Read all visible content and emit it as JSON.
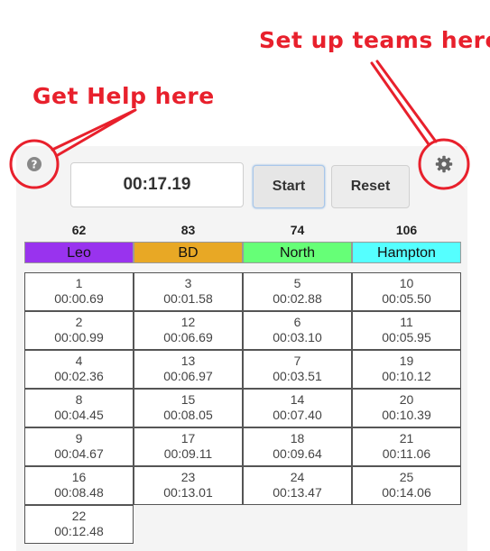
{
  "annotations": {
    "teams_hint": "Set up teams here",
    "help_hint": "Get Help here"
  },
  "timer": {
    "display": "00:17.19"
  },
  "controls": {
    "start_label": "Start",
    "reset_label": "Reset"
  },
  "icons": {
    "help": "help-icon",
    "settings": "gear-icon"
  },
  "colors": {
    "annotation": "#e8202c"
  },
  "teams": [
    {
      "score": "62",
      "name": "Leo",
      "color": "#9933ee",
      "entries": [
        {
          "num": "1",
          "time": "00:00.69"
        },
        {
          "num": "2",
          "time": "00:00.99"
        },
        {
          "num": "4",
          "time": "00:02.36"
        },
        {
          "num": "8",
          "time": "00:04.45"
        },
        {
          "num": "9",
          "time": "00:04.67"
        },
        {
          "num": "16",
          "time": "00:08.48"
        },
        {
          "num": "22",
          "time": "00:12.48"
        }
      ]
    },
    {
      "score": "83",
      "name": "BD",
      "color": "#e8a825",
      "entries": [
        {
          "num": "3",
          "time": "00:01.58"
        },
        {
          "num": "12",
          "time": "00:06.69"
        },
        {
          "num": "13",
          "time": "00:06.97"
        },
        {
          "num": "15",
          "time": "00:08.05"
        },
        {
          "num": "17",
          "time": "00:09.11"
        },
        {
          "num": "23",
          "time": "00:13.01"
        }
      ]
    },
    {
      "score": "74",
      "name": "North",
      "color": "#66ff77",
      "entries": [
        {
          "num": "5",
          "time": "00:02.88"
        },
        {
          "num": "6",
          "time": "00:03.10"
        },
        {
          "num": "7",
          "time": "00:03.51"
        },
        {
          "num": "14",
          "time": "00:07.40"
        },
        {
          "num": "18",
          "time": "00:09.64"
        },
        {
          "num": "24",
          "time": "00:13.47"
        }
      ]
    },
    {
      "score": "106",
      "name": "Hampton",
      "color": "#55ffff",
      "entries": [
        {
          "num": "10",
          "time": "00:05.50"
        },
        {
          "num": "11",
          "time": "00:05.95"
        },
        {
          "num": "19",
          "time": "00:10.12"
        },
        {
          "num": "20",
          "time": "00:10.39"
        },
        {
          "num": "21",
          "time": "00:11.06"
        },
        {
          "num": "25",
          "time": "00:14.06"
        }
      ]
    }
  ]
}
